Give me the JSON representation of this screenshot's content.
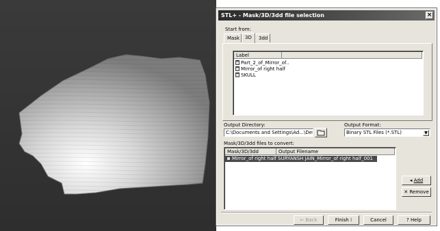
{
  "window": {
    "title": "STL+ - Mask/3D/3dd file selection"
  },
  "start_from": {
    "label": "Start from:",
    "tabs": [
      "Mask",
      "3D",
      "3dd"
    ],
    "active_tab": "3D"
  },
  "file_list": {
    "column_header": "Label",
    "items": [
      "Part_2_of_Mirror_of..",
      "Mirror_of right half",
      "SKULL"
    ]
  },
  "output_directory": {
    "label": "Output Directory:",
    "value": "C:\\Documents and Settings\\Ad...\\Desktop\\"
  },
  "output_format": {
    "label": "Output Format:",
    "value": "Binary STL Files (*.STL)"
  },
  "convert_list": {
    "label": "Mask/3D/3dd files to convert:",
    "headers": [
      "Mask/3D/3dd",
      "Output Filename"
    ],
    "rows": [
      {
        "source": "Mirror_of right half",
        "output": "SURYANSH JAIN_Mirror_of right half_001"
      }
    ]
  },
  "buttons": {
    "add": "Add",
    "remove": "Remove",
    "back": "Back",
    "finish": "Finish",
    "cancel": "Cancel",
    "help": "Help"
  },
  "icons": {
    "close": "×",
    "folder": "folder-icon",
    "add_arrow": "arrow-left-icon",
    "remove_x": "x-icon",
    "help": "help-icon"
  },
  "colors": {
    "dialog_bg": "#e7e4dc",
    "title_bg": "#2b2b2b",
    "selection": "#4a4a4a"
  }
}
